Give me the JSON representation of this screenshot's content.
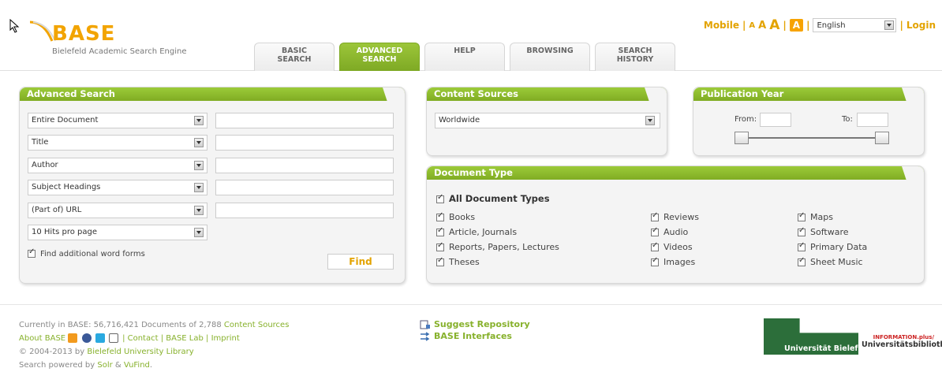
{
  "header": {
    "logo_text": "BASE",
    "logo_subtitle": "Bielefeld Academic Search Engine",
    "mobile_link": "Mobile",
    "font_sizes": [
      "A",
      "A",
      "A",
      "A"
    ],
    "language": "English",
    "login_link": "Login"
  },
  "tabs": [
    {
      "label": "BASIC\nSEARCH",
      "active": false
    },
    {
      "label": "ADVANCED\nSEARCH",
      "active": true
    },
    {
      "label": "HELP",
      "active": false
    },
    {
      "label": "BROWSING",
      "active": false
    },
    {
      "label": "SEARCH\nHISTORY",
      "active": false
    }
  ],
  "advanced": {
    "title": "Advanced Search",
    "fields": [
      {
        "select": "Entire Document",
        "value": ""
      },
      {
        "select": "Title",
        "value": ""
      },
      {
        "select": "Author",
        "value": ""
      },
      {
        "select": "Subject Headings",
        "value": ""
      },
      {
        "select": "(Part of) URL",
        "value": ""
      }
    ],
    "hits_select": "10 Hits pro page",
    "word_forms": "Find additional word forms",
    "find_button": "Find"
  },
  "sources": {
    "title": "Content Sources",
    "selected": "Worldwide"
  },
  "publication": {
    "title": "Publication Year",
    "from_label": "From:",
    "to_label": "To:"
  },
  "doc_type": {
    "title": "Document Type",
    "all": "All Document Types",
    "col1": [
      "Books",
      "Article, Journals",
      "Reports, Papers, Lectures",
      "Theses"
    ],
    "col2": [
      "Reviews",
      "Audio",
      "Videos",
      "Images"
    ],
    "col3": [
      "Maps",
      "Software",
      "Primary Data",
      "Sheet Music"
    ]
  },
  "footer": {
    "line1_prefix": "Currently in BASE: 56,716,421 Documents of 2,788",
    "line1_link": "Content Sources",
    "about": "About BASE",
    "contact": "| Contact | BASE Lab | Imprint",
    "copyright_prefix": "© 2004-2013 by",
    "copyright_link": "Bielefeld University Library",
    "powered_prefix": "Search powered by",
    "powered_solr": "Solr",
    "powered_amp": "&",
    "powered_vufind": "VuFind",
    "powered_suffix": ".",
    "suggest": "Suggest Repository",
    "interfaces": "BASE Interfaces",
    "uni_name": "Universität Bielefeld",
    "lib_top": "INFORMATION.plus/",
    "lib_name": "Universitätsbibliothek"
  }
}
